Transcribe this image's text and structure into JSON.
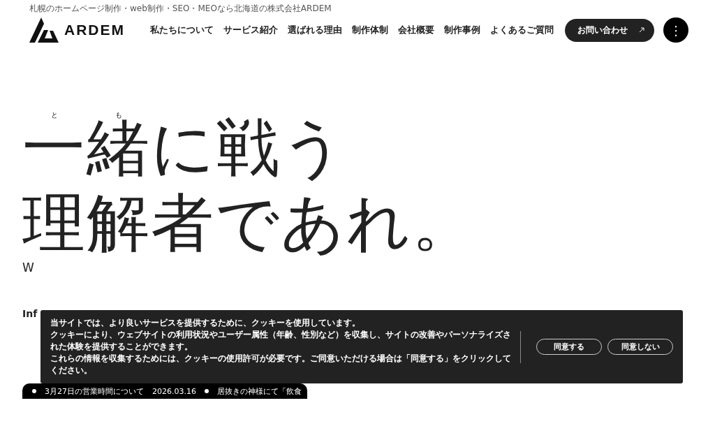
{
  "header": {
    "tagline": "札幌のホームページ制作・web制作・SEO・MEOなら北海道の株式会社ARDEM",
    "logo": "ARDEM",
    "nav": [
      "私たちについて",
      "サービス紹介",
      "選ばれる理由",
      "制作体制",
      "会社概要",
      "制作事例",
      "よくあるご質問"
    ],
    "contact_button": "お問い合わせ",
    "menu_button": "⋮"
  },
  "hero": {
    "lines": [
      [
        {
          "text": "一",
          "ruby": "と"
        },
        {
          "text": "緒",
          "ruby": "も"
        },
        {
          "text": "に戦う"
        }
      ],
      [
        {
          "text": "理解者であれ。"
        }
      ]
    ],
    "subtitle": "W",
    "info_label": "Inf",
    "news": [
      {
        "title": "3月27日の営業時間について"
      },
      {
        "date": "2026.03.16",
        "title": "居抜きの神様にて「飲食"
      }
    ]
  },
  "cookie_banner": {
    "lines": [
      "当サイトでは、より良いサービスを提供するために、クッキーを使用しています。",
      "クッキーにより、ウェブサイトの利用状況やユーザー属性（年齢、性別など）を収集し、サイトの改善やパーソナライズされた体験を提供することができます。",
      "これらの情報を収集するためには、クッキーの使用許可が必要です。ご同意いただける場合は「同意する」をクリックしてください。"
    ],
    "buttons": [
      "同意する",
      "同意しない"
    ]
  }
}
